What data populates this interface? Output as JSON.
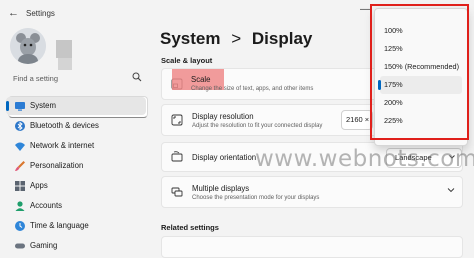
{
  "window": {
    "title": "Settings"
  },
  "sidebar": {
    "search_placeholder": "Find a setting",
    "items": [
      {
        "label": "System",
        "icon": "monitor-icon",
        "selected": true
      },
      {
        "label": "Bluetooth & devices",
        "icon": "bluetooth-icon",
        "selected": false
      },
      {
        "label": "Network & internet",
        "icon": "wifi-icon",
        "selected": false
      },
      {
        "label": "Personalization",
        "icon": "brush-icon",
        "selected": false
      },
      {
        "label": "Apps",
        "icon": "apps-icon",
        "selected": false
      },
      {
        "label": "Accounts",
        "icon": "person-icon",
        "selected": false
      },
      {
        "label": "Time & language",
        "icon": "clock-globe-icon",
        "selected": false
      },
      {
        "label": "Gaming",
        "icon": "controller-icon",
        "selected": false
      }
    ]
  },
  "main": {
    "breadcrumb_parent": "System",
    "breadcrumb_sep": ">",
    "breadcrumb_current": "Display",
    "section_title": "Scale & layout",
    "scale": {
      "title": "Scale",
      "subtitle": "Change the size of text, apps, and other items"
    },
    "resolution": {
      "title": "Display resolution",
      "subtitle": "Adjust the resolution to fit your connected display",
      "value": "2160 ×"
    },
    "orientation": {
      "title": "Display orientation",
      "value": "Landscape"
    },
    "multiple": {
      "title": "Multiple displays",
      "subtitle": "Choose the presentation mode for your displays"
    },
    "related_title": "Related settings"
  },
  "dropdown": {
    "options": [
      "100%",
      "125%",
      "150% (Recommended)",
      "175%",
      "200%",
      "225%"
    ],
    "selected_index": 3
  },
  "watermark": "www.webnots.com",
  "colors": {
    "accent": "#0067c0",
    "highlight": "#e0201b"
  }
}
